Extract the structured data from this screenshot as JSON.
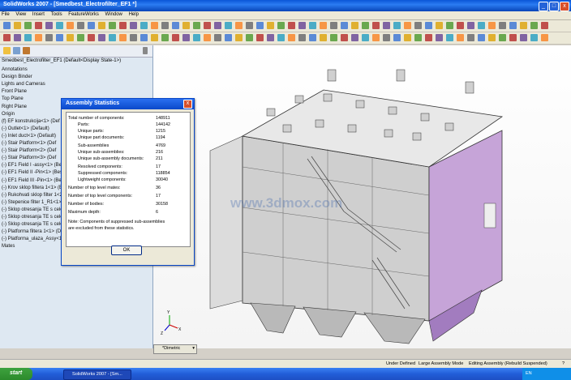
{
  "window": {
    "title": "SolidWorks 2007 - [Smedbest_Electrofilter_EF1 *]",
    "minimize_label": "_",
    "maximize_label": "□",
    "close_label": "x"
  },
  "menu": [
    "File",
    "View",
    "Insert",
    "Tools",
    "FeatureWorks",
    "Window",
    "Help"
  ],
  "tree": {
    "header": "Smedbest_Electrofilter_EF1  (Default<Display State-1>)",
    "items": [
      "Annotations",
      "Design Binder",
      "Lights and Cameras",
      "Front Plane",
      "Top Plane",
      "Right Plane",
      "Origin",
      "(f) EF konstrukcija<1> (Def",
      "(-) Outlet<1> (Default)",
      "(-) Inlet duct<1> (Default)",
      "(-) Stair Platform<1> (Def",
      "(-) Stair Platform<2> (Def",
      "(-) Stair Platform<3> (Def",
      "(-) EF1 Field I -assy<1> (Bes",
      "(-) EF1 Field II -Pin<1> (Bes",
      "(-) EF1 Field III -Pin<1> (Bes",
      "(-) Krov sklop filtera 1<1> (Be",
      "(-) Rukohvati sklop filter 1<2>",
      "(-) Stepenice filter 1_R1<1> (",
      "(-) Sklop otresanja TE s celok",
      "(-) Sklop otresanja TE s celok",
      "(-) Sklop otresanja TE s celok",
      "(-) Platforma filtera 1<1> (De",
      "(-) Platforma_ulaza_Assy<1>",
      "Mates"
    ]
  },
  "dialog": {
    "title": "Assembly Statistics",
    "close_label": "x",
    "rows": [
      {
        "label": "Total number of components:",
        "value": "148911"
      },
      {
        "label": "Parts:",
        "value": "144142"
      },
      {
        "label": "Unique parts:",
        "value": "1215"
      },
      {
        "label": "Unique part documents:",
        "value": "1194"
      },
      {
        "label": "Sub-assemblies",
        "value": "4769"
      },
      {
        "label": "Unique sub-assemblies:",
        "value": "216"
      },
      {
        "label": "Unique sub-assembly documents:",
        "value": "211"
      },
      {
        "label": "Resolved components:",
        "value": "17"
      },
      {
        "label": "Suppressed components:",
        "value": "118854"
      },
      {
        "label": "Lightweight components:",
        "value": "30040"
      },
      {
        "label": "Number of top level mates:",
        "value": "36"
      },
      {
        "label": "Number of top level components:",
        "value": "17"
      },
      {
        "label": "Number of bodies:",
        "value": "30158"
      },
      {
        "label": "Maximum depth:",
        "value": "6"
      }
    ],
    "note_line1": "Note: Components of suppressed sub-assemblies",
    "note_line2": "are excluded from these statistics.",
    "ok_label": "OK"
  },
  "watermark": "www.3dmox.com",
  "triad": {
    "x": "X",
    "y": "Y",
    "z": "Z"
  },
  "config_tab": "*Dimetric",
  "status": {
    "left": "Under Defined",
    "mode": "Large Assembly Mode",
    "editing": "Editing Assembly (Rebuild Suspended)",
    "help": "?"
  },
  "taskbar": {
    "start_label": "start",
    "task_label": "SolidWorks 2007 - [Sm...",
    "tray_text": "EN"
  },
  "colors": {
    "accent": "#0a56d6",
    "model_purple": "#c6a4d8",
    "model_grey": "#d9d9d9"
  }
}
